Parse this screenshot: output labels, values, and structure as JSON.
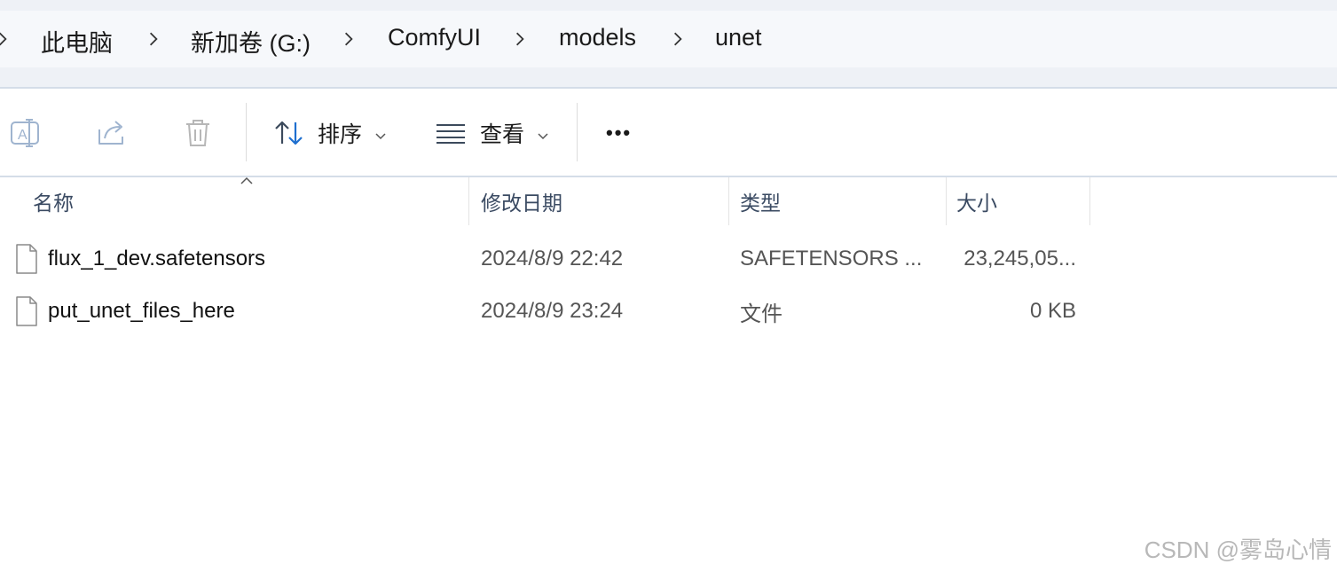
{
  "breadcrumb": {
    "items": [
      "此电脑",
      "新加卷 (G:)",
      "ComfyUI",
      "models",
      "unet"
    ]
  },
  "toolbar": {
    "rename_icon": "rename-icon",
    "share_icon": "share-icon",
    "delete_icon": "trash-icon",
    "sort_label": "排序",
    "view_label": "查看",
    "more_label": "•••"
  },
  "columns": {
    "name": "名称",
    "date": "修改日期",
    "type": "类型",
    "size": "大小"
  },
  "files": [
    {
      "name": "flux_1_dev.safetensors",
      "date": "2024/8/9 22:42",
      "type": "SAFETENSORS ...",
      "size": "23,245,05..."
    },
    {
      "name": "put_unet_files_here",
      "date": "2024/8/9 23:24",
      "type": "文件",
      "size": "0 KB"
    }
  ],
  "watermark": "CSDN @雾岛心情",
  "colors": {
    "address_bg": "#f6f8fb",
    "header_text": "#3a4a62",
    "sort_arrow_blue": "#1f6fcf"
  }
}
